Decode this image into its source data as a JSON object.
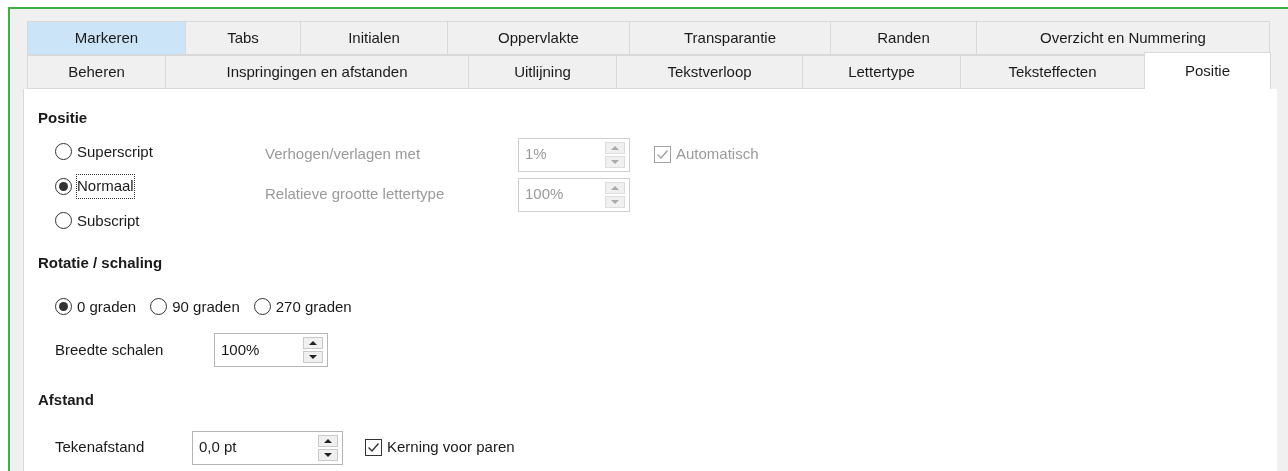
{
  "tabs_row_1": [
    {
      "label": "Markeren",
      "selected": false,
      "highlighted": true
    },
    {
      "label": "Tabs",
      "selected": false,
      "highlighted": false
    },
    {
      "label": "Initialen",
      "selected": false,
      "highlighted": false
    },
    {
      "label": "Oppervlakte",
      "selected": false,
      "highlighted": false
    },
    {
      "label": "Transparantie",
      "selected": false,
      "highlighted": false
    },
    {
      "label": "Randen",
      "selected": false,
      "highlighted": false
    },
    {
      "label": "Overzicht en Nummering",
      "selected": false,
      "highlighted": false
    }
  ],
  "tabs_row_2": [
    {
      "label": "Beheren",
      "selected": false,
      "highlighted": false
    },
    {
      "label": "Inspringingen en afstanden",
      "selected": false,
      "highlighted": false
    },
    {
      "label": "Uitlijning",
      "selected": false,
      "highlighted": false
    },
    {
      "label": "Tekstverloop",
      "selected": false,
      "highlighted": false
    },
    {
      "label": "Lettertype",
      "selected": false,
      "highlighted": false
    },
    {
      "label": "Teksteffecten",
      "selected": false,
      "highlighted": false
    },
    {
      "label": "Positie",
      "selected": true,
      "highlighted": false
    }
  ],
  "position": {
    "heading": "Positie",
    "options": [
      {
        "label": "Superscript",
        "selected": false,
        "focused": false
      },
      {
        "label": "Normaal",
        "selected": true,
        "focused": true
      },
      {
        "label": "Subscript",
        "selected": false,
        "focused": false
      }
    ],
    "raise_lower": {
      "label": "Verhogen/verlagen met",
      "value": "1%",
      "disabled": true
    },
    "relative_size": {
      "label": "Relatieve grootte lettertype",
      "value": "100%",
      "disabled": true
    },
    "automatic": {
      "label": "Automatisch",
      "checked": true,
      "disabled": true
    }
  },
  "rotation": {
    "heading": "Rotatie / schaling",
    "options": [
      {
        "label": "0 graden",
        "selected": true
      },
      {
        "label": "90 graden",
        "selected": false
      },
      {
        "label": "270 graden",
        "selected": false
      }
    ],
    "scale_width": {
      "label": "Breedte schalen",
      "value": "100%"
    }
  },
  "spacing": {
    "heading": "Afstand",
    "character_spacing": {
      "label": "Tekenafstand",
      "value": "0,0 pt"
    },
    "pair_kerning": {
      "label": "Kerning voor paren",
      "checked": true
    }
  }
}
